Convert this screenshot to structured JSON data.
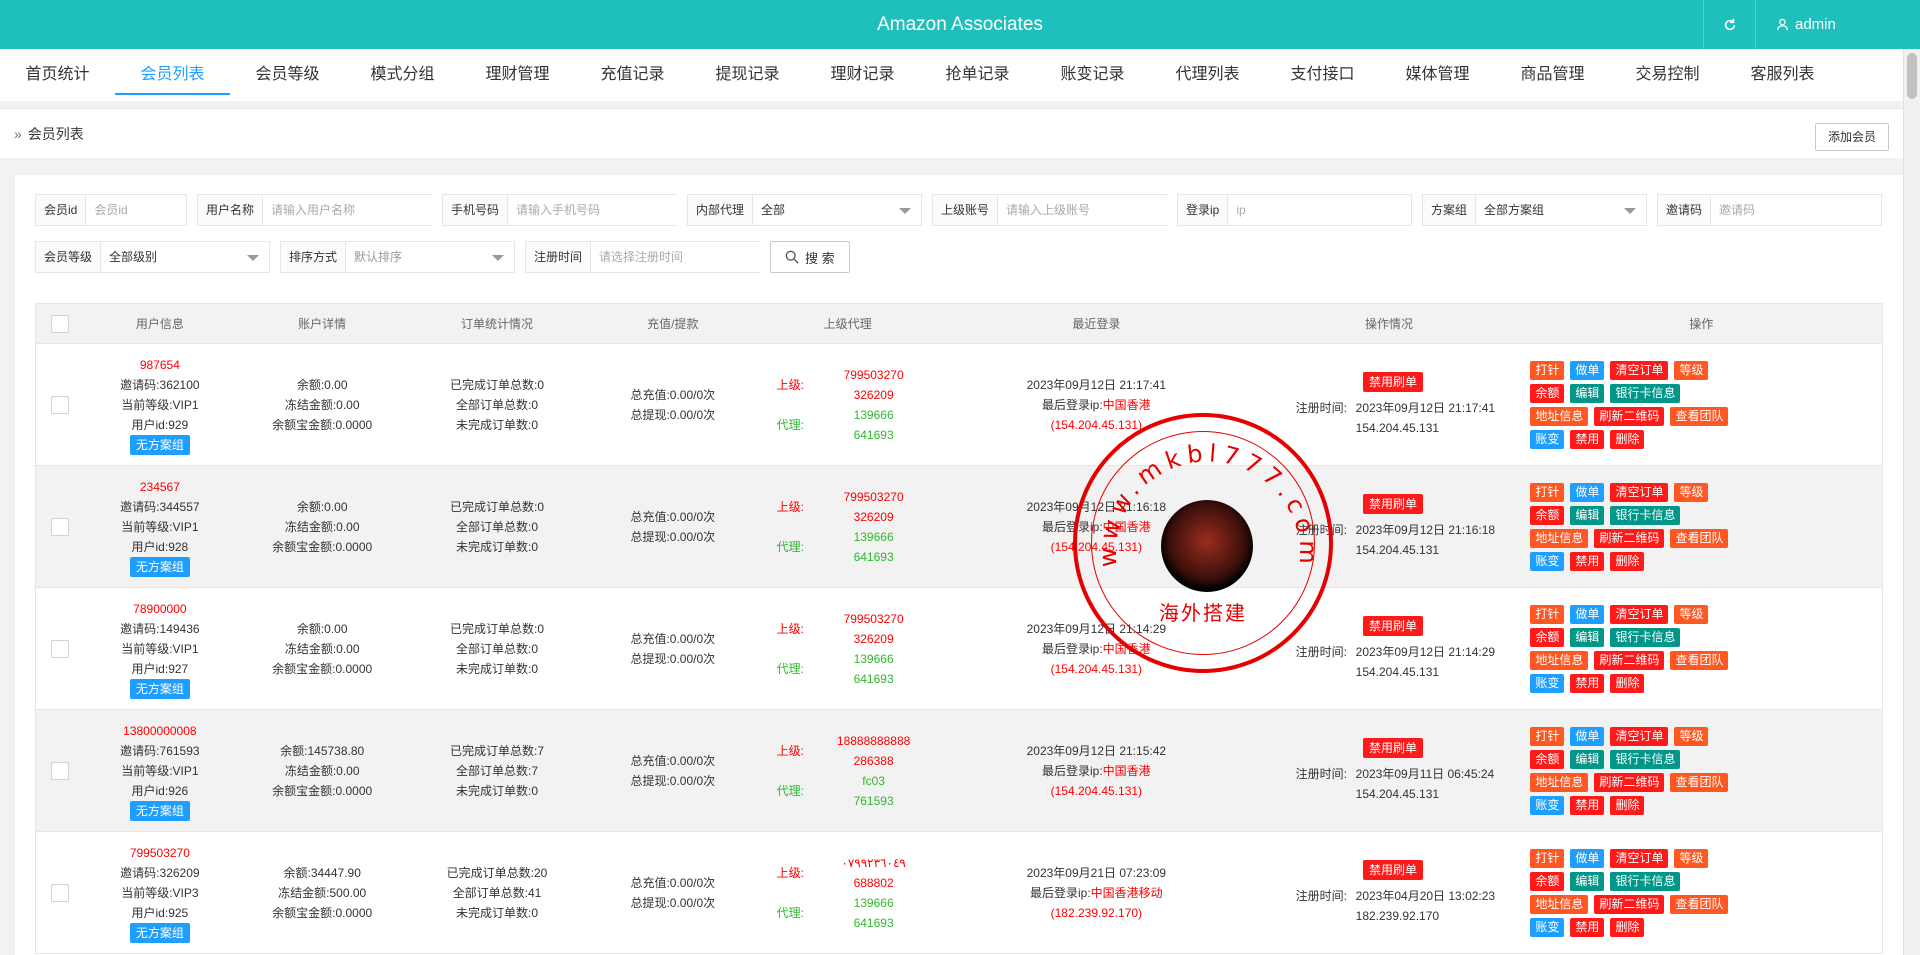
{
  "header": {
    "title": "Amazon Associates",
    "user": "admin"
  },
  "nav": [
    "首页统计",
    "会员列表",
    "会员等级",
    "模式分组",
    "理财管理",
    "充值记录",
    "提现记录",
    "理财记录",
    "抢单记录",
    "账变记录",
    "代理列表",
    "支付接口",
    "媒体管理",
    "商品管理",
    "交易控制",
    "客服列表"
  ],
  "breadcrumb": "会员列表",
  "add_button": "添加会员",
  "filters": {
    "member_id": {
      "label": "会员id",
      "placeholder": "会员id"
    },
    "username": {
      "label": "用户名称",
      "placeholder": "请输入用户名称"
    },
    "phone": {
      "label": "手机号码",
      "placeholder": "请输入手机号码"
    },
    "internal_agent": {
      "label": "内部代理",
      "value": "全部"
    },
    "parent_account": {
      "label": "上级账号",
      "placeholder": "请输入上级账号"
    },
    "login_ip": {
      "label": "登录ip",
      "placeholder": "ip"
    },
    "plan_group": {
      "label": "方案组",
      "value": "全部方案组"
    },
    "invite_code": {
      "label": "邀请码",
      "placeholder": "邀请码"
    },
    "member_level": {
      "label": "会员等级",
      "value": "全部级别"
    },
    "sort": {
      "label": "排序方式",
      "value": "默认排序"
    },
    "register_time": {
      "label": "注册时间",
      "placeholder": "请选择注册时间"
    },
    "search_button": "搜 索"
  },
  "table": {
    "headers": [
      "用户信息",
      "账户详情",
      "订单统计情况",
      "充值/提款",
      "上级代理",
      "最近登录",
      "操作情况",
      "操作"
    ],
    "labels": {
      "invite": "邀请码:",
      "level": "当前等级:",
      "uid": "用户id:",
      "balance": "余额:",
      "frozen": "冻结金额:",
      "wealth": "余额宝金额:",
      "done": "已完成订单总数:",
      "all": "全部订单总数:",
      "undone": "未完成订单数:",
      "recharge": "总充值:",
      "withdraw": "总提现:",
      "upper": "上级:",
      "agent": "代理:",
      "last_ip": "最后登录ip:",
      "reg_time": "注册时间:",
      "ban": "禁用刷单"
    },
    "actions": {
      "punch": "打针",
      "make_order": "做单",
      "clear_order": "清空订单",
      "level": "等级",
      "balance": "余额",
      "edit": "编辑",
      "bank": "银行卡信息",
      "address": "地址信息",
      "refresh_qr": "刷新二维码",
      "team": "查看团队",
      "account_change": "账变",
      "disable": "禁用",
      "delete": "删除"
    },
    "rows": [
      {
        "username": "987654",
        "invite": "362100",
        "level": "VIP1",
        "uid": "929",
        "group": "无方案组",
        "balance": "0.00",
        "frozen": "0.00",
        "wealth": "0.0000",
        "done": "0",
        "all": "0",
        "undone": "0",
        "recharge": "0.00/0次",
        "withdraw": "0.00/0次",
        "upper1": "799503270",
        "upper2": "326209",
        "agent1": "139666",
        "agent2": "641693",
        "login_time": "2023年09月12日 21:17:41",
        "login_loc": "中国香港",
        "login_ip": "(154.204.45.131)",
        "reg_time": "2023年09月12日 21:17:41",
        "reg_ip": "154.204.45.131"
      },
      {
        "username": "234567",
        "invite": "344557",
        "level": "VIP1",
        "uid": "928",
        "group": "无方案组",
        "balance": "0.00",
        "frozen": "0.00",
        "wealth": "0.0000",
        "done": "0",
        "all": "0",
        "undone": "0",
        "recharge": "0.00/0次",
        "withdraw": "0.00/0次",
        "upper1": "799503270",
        "upper2": "326209",
        "agent1": "139666",
        "agent2": "641693",
        "login_time": "2023年09月12日 21:16:18",
        "login_loc": "中国香港",
        "login_ip": "(154.204.45.131)",
        "reg_time": "2023年09月12日 21:16:18",
        "reg_ip": "154.204.45.131"
      },
      {
        "username": "78900000",
        "invite": "149436",
        "level": "VIP1",
        "uid": "927",
        "group": "无方案组",
        "balance": "0.00",
        "frozen": "0.00",
        "wealth": "0.0000",
        "done": "0",
        "all": "0",
        "undone": "0",
        "recharge": "0.00/0次",
        "withdraw": "0.00/0次",
        "upper1": "799503270",
        "upper2": "326209",
        "agent1": "139666",
        "agent2": "641693",
        "login_time": "2023年09月12日 21:14:29",
        "login_loc": "中国香港",
        "login_ip": "(154.204.45.131)",
        "reg_time": "2023年09月12日 21:14:29",
        "reg_ip": "154.204.45.131"
      },
      {
        "username": "13800000008",
        "invite": "761593",
        "level": "VIP1",
        "uid": "926",
        "group": "无方案组",
        "balance": "145738.80",
        "frozen": "0.00",
        "wealth": "0.0000",
        "done": "7",
        "all": "7",
        "undone": "0",
        "recharge": "0.00/0次",
        "withdraw": "0.00/0次",
        "upper1": "18888888888",
        "upper2": "286388",
        "agent1": "fc03",
        "agent2": "761593",
        "login_time": "2023年09月12日 21:15:42",
        "login_loc": "中国香港",
        "login_ip": "(154.204.45.131)",
        "reg_time": "2023年09月11日 06:45:24",
        "reg_ip": "154.204.45.131"
      },
      {
        "username": "799503270",
        "invite": "326209",
        "level": "VIP3",
        "uid": "925",
        "group": "无方案组",
        "balance": "34447.90",
        "frozen": "500.00",
        "wealth": "0.0000",
        "done": "20",
        "all": "41",
        "undone": "0",
        "recharge": "0.00/0次",
        "withdraw": "0.00/0次",
        "upper1": "٠٧٩٩٢٣٦٠٤٩",
        "upper2": "688802",
        "agent1": "139666",
        "agent2": "641693",
        "login_time": "2023年09月21日 07:23:09",
        "login_loc": "中国香港移动",
        "login_ip": "(182.239.92.170)",
        "reg_time": "2023年04月20日 13:02:23",
        "reg_ip": "182.239.92.170"
      }
    ]
  },
  "watermark": {
    "url_text": "www.mkbl777.com",
    "caption": "海外搭建"
  }
}
